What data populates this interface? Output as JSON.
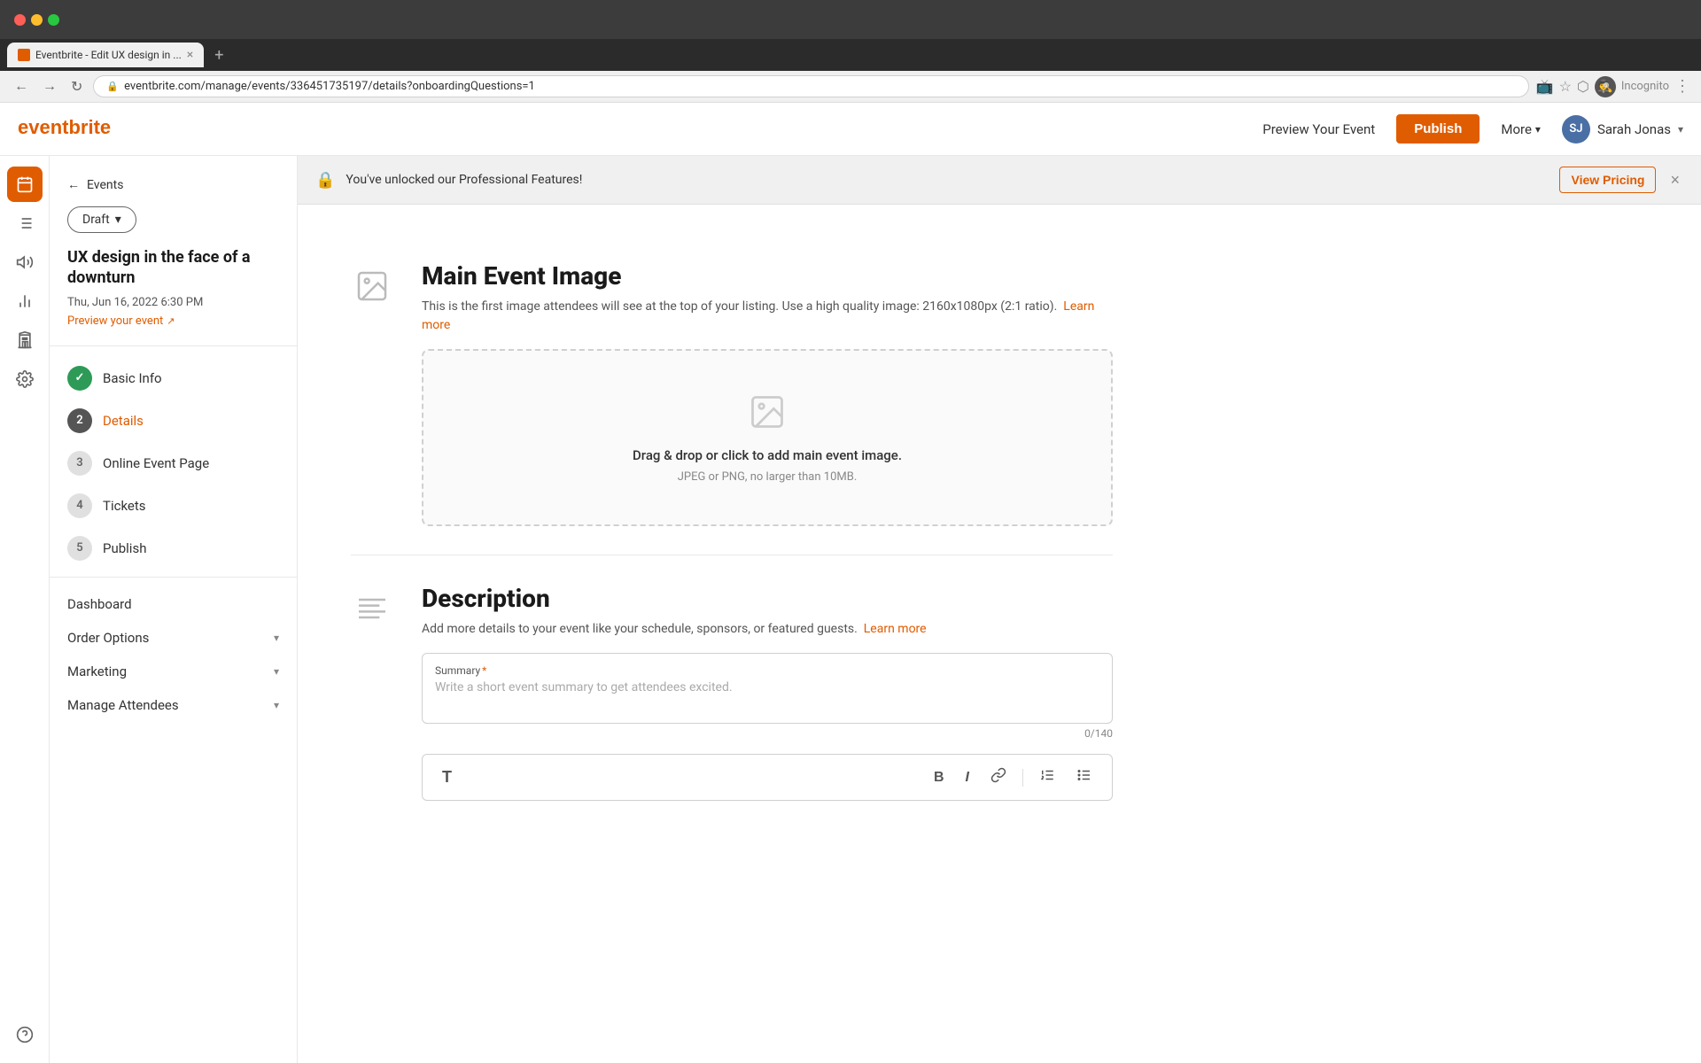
{
  "browser": {
    "tab_title": "Eventbrite - Edit UX design in ...",
    "url": "eventbrite.com/manage/events/336451735197/details?onboardingQuestions=1",
    "new_tab_label": "+",
    "incognito_label": "Incognito"
  },
  "nav": {
    "logo": "eventbrite",
    "preview_event": "Preview Your Event",
    "publish": "Publish",
    "more": "More",
    "user_initials": "SJ",
    "user_name": "Sarah Jonas"
  },
  "banner": {
    "lock_icon": "🔒",
    "message": "You've unlocked our Professional Features!",
    "view_pricing": "View Pricing",
    "close_icon": "×"
  },
  "sidebar": {
    "back_label": "Events",
    "draft_label": "Draft",
    "event_title": "UX design in the face of a downturn",
    "event_date": "Thu, Jun 16, 2022 6:30 PM",
    "preview_link": "Preview your event",
    "menu_items": [
      {
        "id": "basic-info",
        "step": "✓",
        "label": "Basic Info",
        "type": "completed"
      },
      {
        "id": "details",
        "step": "2",
        "label": "Details",
        "type": "active"
      },
      {
        "id": "online-event-page",
        "step": "3",
        "label": "Online Event Page",
        "type": "inactive"
      },
      {
        "id": "tickets",
        "step": "4",
        "label": "Tickets",
        "type": "inactive"
      },
      {
        "id": "publish",
        "step": "5",
        "label": "Publish",
        "type": "inactive"
      }
    ],
    "section_items": [
      {
        "id": "dashboard",
        "label": "Dashboard"
      },
      {
        "id": "order-options",
        "label": "Order Options"
      },
      {
        "id": "marketing",
        "label": "Marketing"
      },
      {
        "id": "manage-attendees",
        "label": "Manage Attendees"
      }
    ]
  },
  "main_event_image": {
    "title": "Main Event Image",
    "description": "This is the first image attendees will see at the top of your listing. Use a high quality image: 2160x1080px (2:1 ratio).",
    "learn_more": "Learn more",
    "upload_text": "Drag & drop or click to add main event image.",
    "upload_subtext": "JPEG or PNG, no larger than 10MB."
  },
  "description": {
    "title": "Description",
    "description": "Add more details to your event like your schedule, sponsors, or featured guests.",
    "learn_more": "Learn more",
    "summary_label": "Summary",
    "summary_placeholder": "Write a short event summary to get attendees excited.",
    "char_count": "0/140",
    "toolbar": {
      "format_icon": "T",
      "bold": "B",
      "italic": "I",
      "link": "⛓",
      "ordered_list": "≡",
      "unordered_list": "☰"
    }
  },
  "sidebar_icons": {
    "calendar": "📅",
    "list": "☰",
    "megaphone": "📢",
    "chart": "📊",
    "building": "🏛",
    "gear": "⚙",
    "help": "?"
  }
}
